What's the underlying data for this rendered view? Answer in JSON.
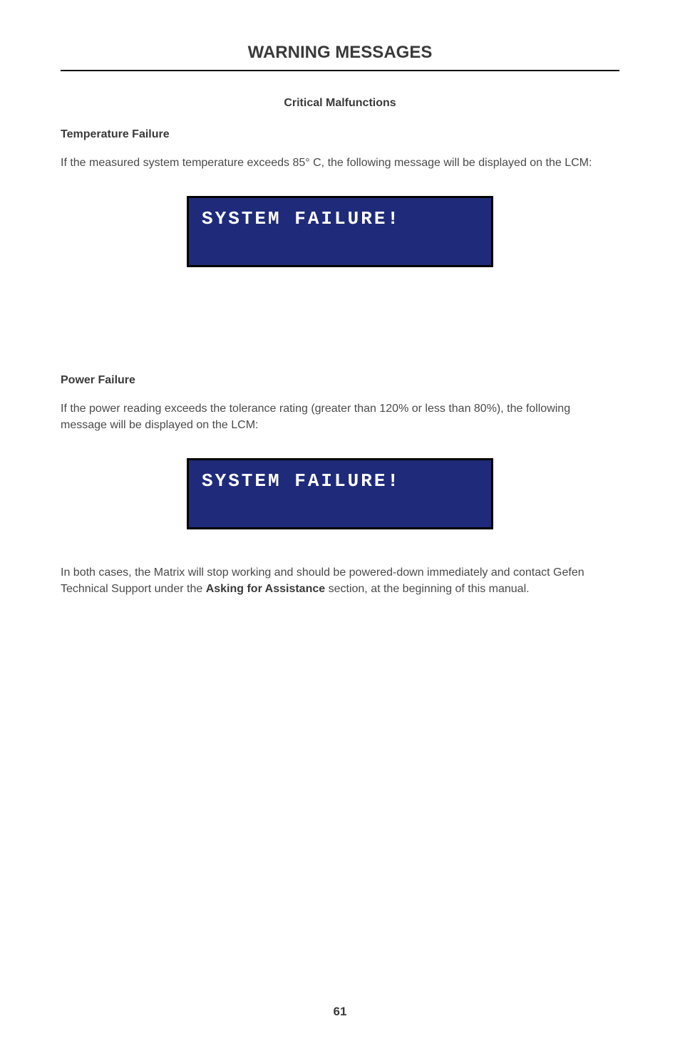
{
  "page_title": "WARNING MESSAGES",
  "subtitle": "Critical Malfunctions",
  "section1": {
    "heading": "Temperature Failure",
    "body": "If the measured system temperature exceeds 85° C, the following message will be displayed on the LCM:",
    "lcm_message": "SYSTEM FAILURE!"
  },
  "section2": {
    "heading": "Power Failure",
    "body": "If the power reading exceeds the tolerance rating (greater than 120% or less than 80%), the following message will be displayed on the LCM:",
    "lcm_message": "SYSTEM FAILURE!"
  },
  "final_paragraph": {
    "part1": "In both cases, the Matrix will stop working and should be powered-down immediately and contact Gefen Technical Support under the ",
    "bold": "Asking for Assistance",
    "part2": " section, at the beginning of this manual."
  },
  "page_number": "61"
}
